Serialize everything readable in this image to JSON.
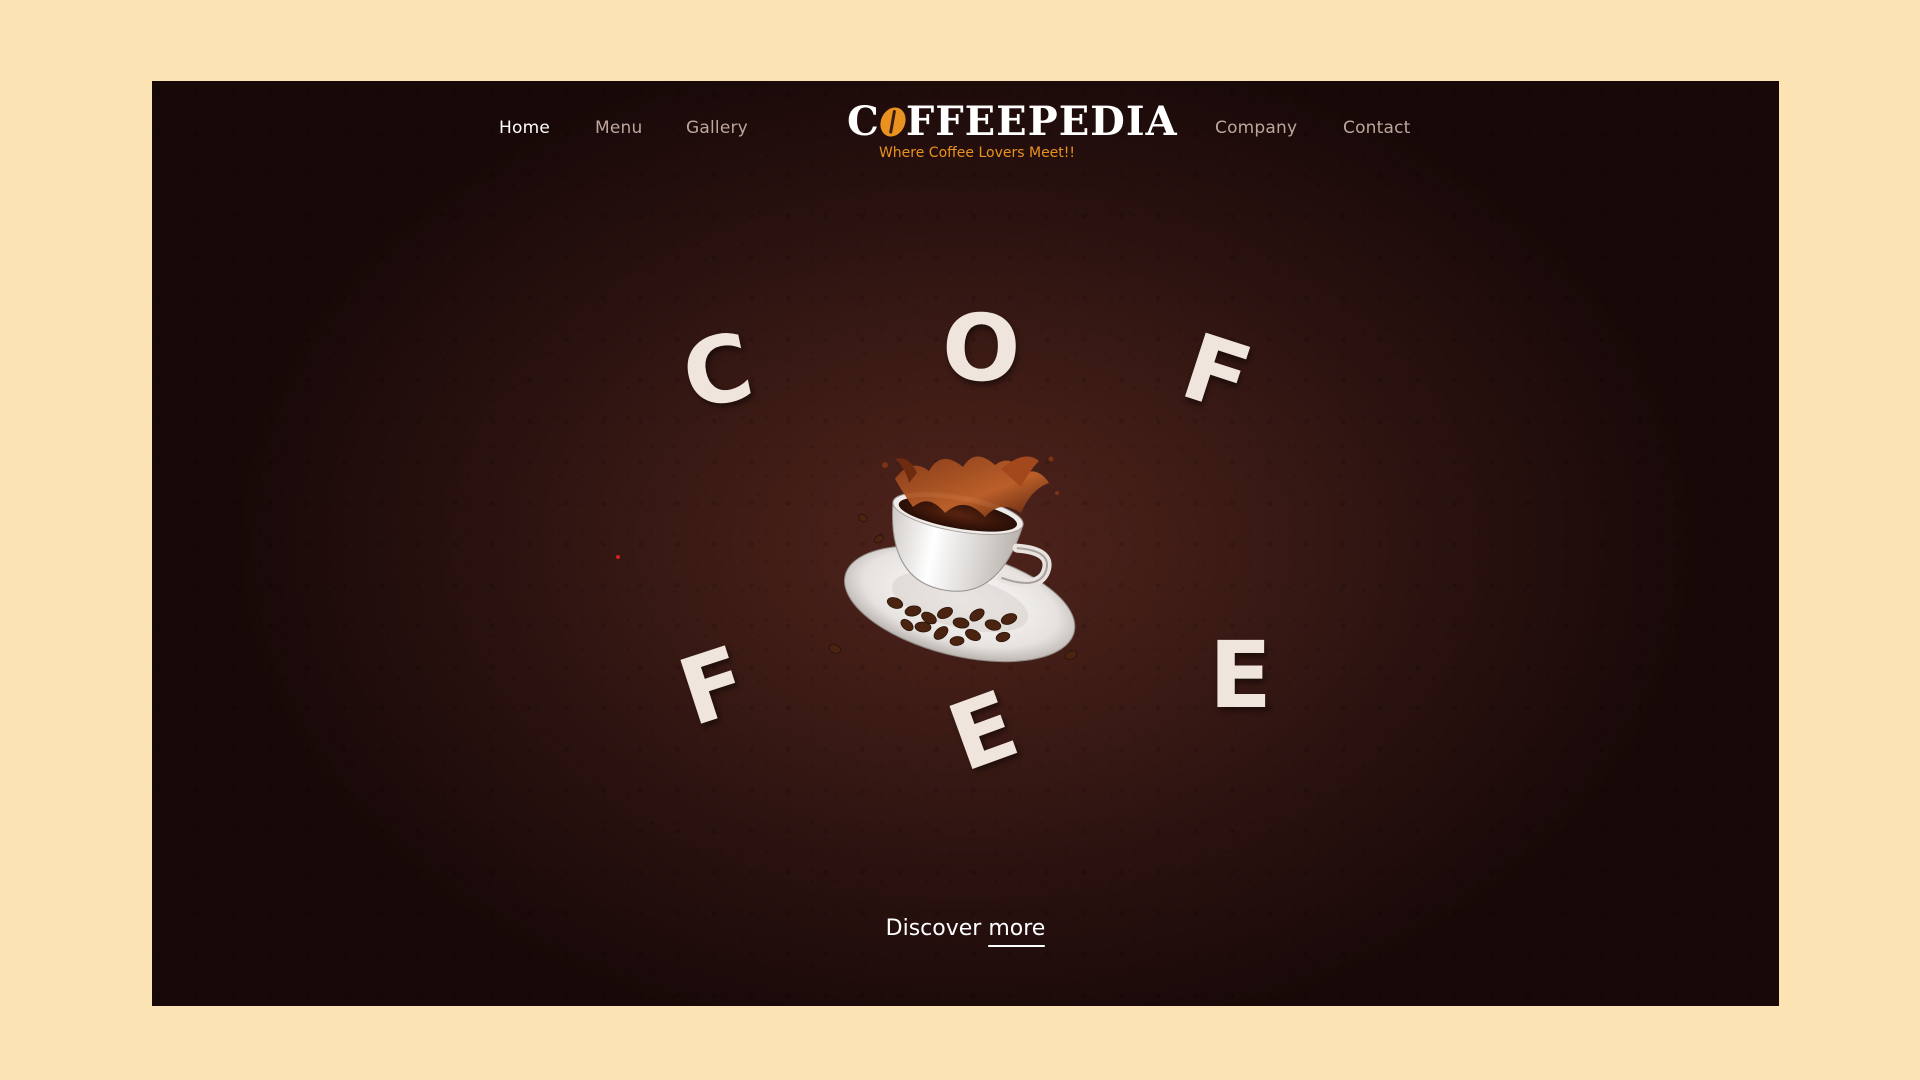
{
  "nav": {
    "left": [
      {
        "label": "Home",
        "active": true
      },
      {
        "label": "Menu",
        "active": false
      },
      {
        "label": "Gallery",
        "active": false
      }
    ],
    "right": [
      {
        "label": "Company",
        "active": false
      },
      {
        "label": "Contact",
        "active": false
      }
    ]
  },
  "logo": {
    "first_letter": "C",
    "rest": "FFEEPEDIA",
    "tagline": "Where Coffee Lovers Meet!!",
    "bean_icon": "coffee-bean-icon"
  },
  "hero": {
    "letters": [
      "C",
      "O",
      "F",
      "F",
      "E",
      "E"
    ],
    "illustration": "coffee-cup-splash-with-beans"
  },
  "cta": {
    "prefix": "Discover",
    "emphasis": "more"
  },
  "colors": {
    "page_background": "#fbe3b4",
    "hero_background": "#3d1b15",
    "accent": "#e99220",
    "letter": "#efe5dc",
    "nav_inactive": "#bda69c",
    "nav_active": "#ffffff"
  }
}
